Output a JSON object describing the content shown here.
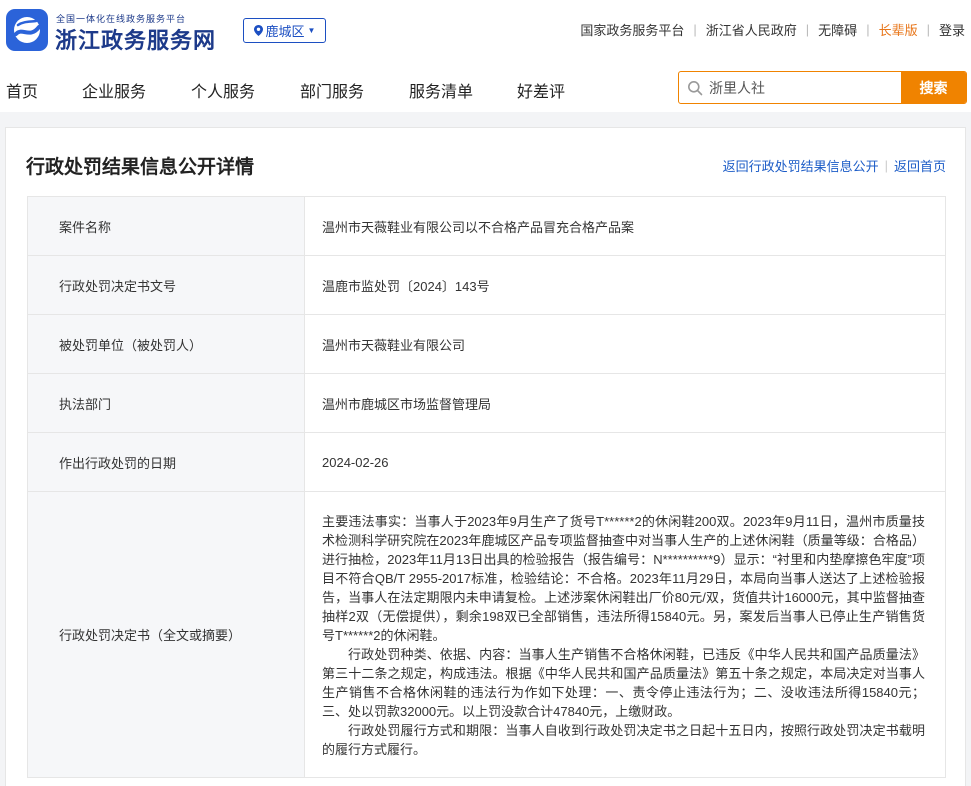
{
  "header": {
    "logo_sub": "全国一体化在线政务服务平台",
    "logo_main": "浙江政务服务网",
    "region": "鹿城区",
    "links": [
      "国家政务服务平台",
      "浙江省人民政府",
      "无障碍",
      "长辈版",
      "登录"
    ]
  },
  "nav": {
    "items": [
      "首页",
      "企业服务",
      "个人服务",
      "部门服务",
      "服务清单",
      "好差评"
    ]
  },
  "search": {
    "placeholder": "浙里人社",
    "button": "搜索"
  },
  "colors": {
    "brand_blue": "#1d3a8a",
    "link_blue": "#1c5cc7",
    "accent_orange": "#f08300"
  },
  "page": {
    "title": "行政处罚结果信息公开详情",
    "crumb_back": "返回行政处罚结果信息公开",
    "crumb_home": "返回首页"
  },
  "details": {
    "rows": [
      {
        "label": "案件名称",
        "value": "温州市天薇鞋业有限公司以不合格产品冒充合格产品案"
      },
      {
        "label": "行政处罚决定书文号",
        "value": "温鹿市监处罚〔2024〕143号"
      },
      {
        "label": "被处罚单位（被处罚人）",
        "value": "温州市天薇鞋业有限公司"
      },
      {
        "label": "执法部门",
        "value": "温州市鹿城区市场监督管理局"
      },
      {
        "label": "作出行政处罚的日期",
        "value": "2024-02-26"
      }
    ],
    "decision_label": "行政处罚决定书（全文或摘要）",
    "decision_paragraphs": [
      "主要违法事实：当事人于2023年9月生产了货号T******2的休闲鞋200双。2023年9月11日，温州市质量技术检测科学研究院在2023年鹿城区产品专项监督抽查中对当事人生产的上述休闲鞋（质量等级：合格品）进行抽检，2023年11月13日出具的检验报告（报告编号：N**********9）显示：“衬里和内垫摩擦色牢度”项目不符合QB/T 2955-2017标准，检验结论：不合格。2023年11月29日，本局向当事人送达了上述检验报告，当事人在法定期限内未申请复检。上述涉案休闲鞋出厂价80元/双，货值共计16000元，其中监督抽查抽样2双（无偿提供），剩余198双已全部销售，违法所得15840元。另，案发后当事人已停止生产销售货号T******2的休闲鞋。",
      "行政处罚种类、依据、内容：当事人生产销售不合格休闲鞋，已违反《中华人民共和国产品质量法》第三十二条之规定，构成违法。根据《中华人民共和国产品质量法》第五十条之规定，本局决定对当事人生产销售不合格休闲鞋的违法行为作如下处理：一、责令停止违法行为；二、没收违法所得15840元；三、处以罚款32000元。以上罚没款合计47840元，上缴财政。",
      "行政处罚履行方式和期限：当事人自收到行政处罚决定书之日起十五日内，按照行政处罚决定书载明的履行方式履行。"
    ]
  }
}
